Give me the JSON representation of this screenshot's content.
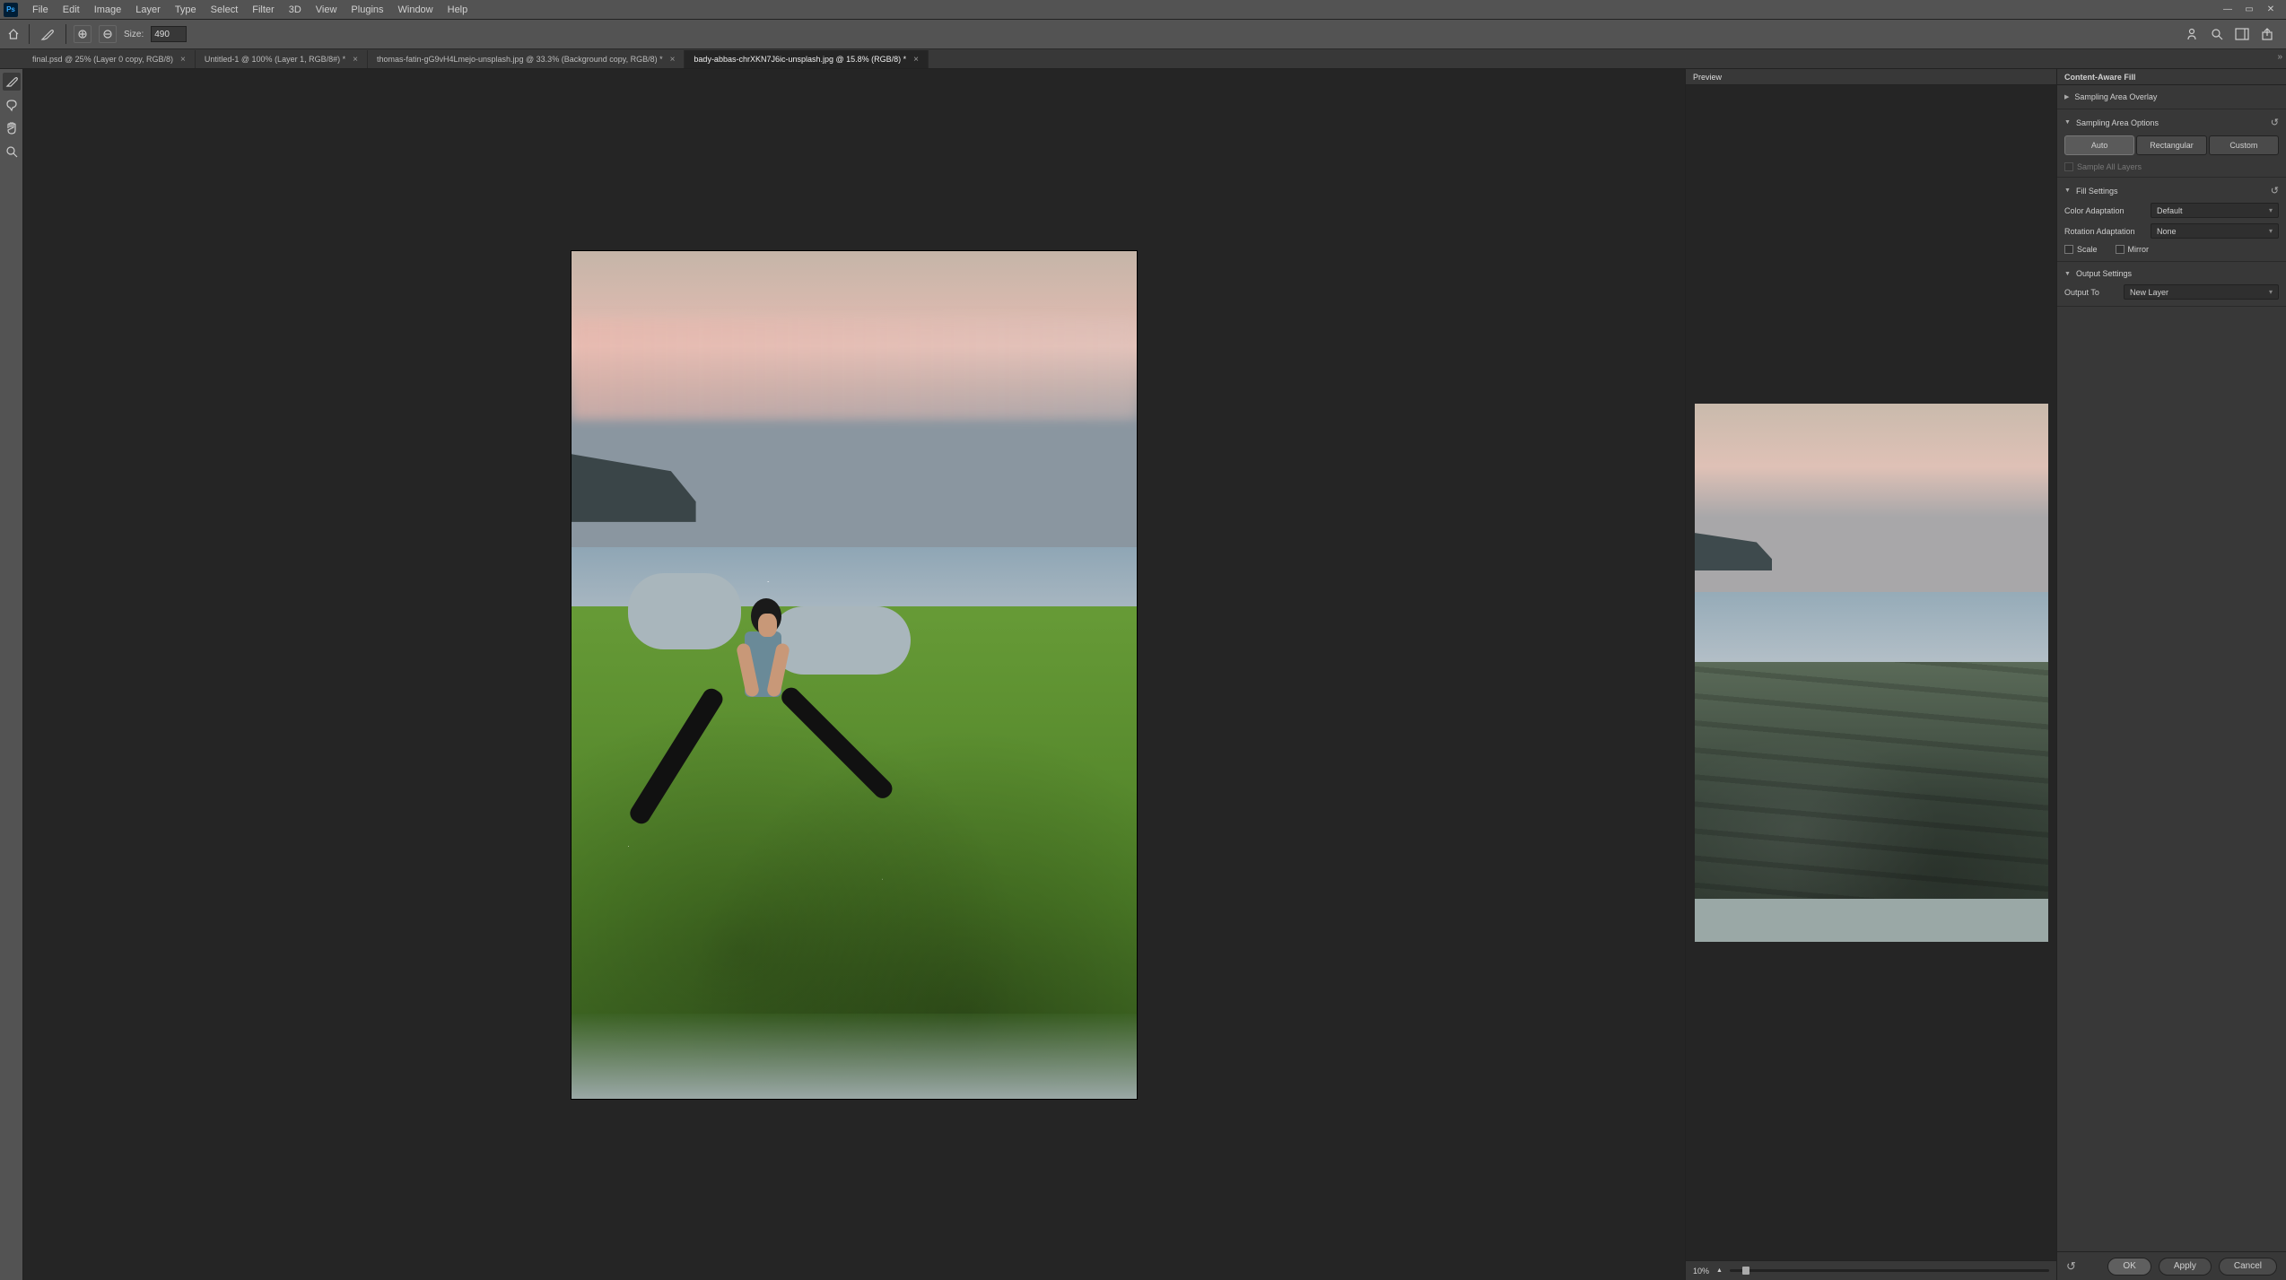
{
  "menubar": [
    "File",
    "Edit",
    "Image",
    "Layer",
    "Type",
    "Select",
    "Filter",
    "3D",
    "View",
    "Plugins",
    "Window",
    "Help"
  ],
  "optionsbar": {
    "size_label": "Size:",
    "size_value": "490"
  },
  "tabs": [
    {
      "label": "final.psd @ 25% (Layer 0 copy, RGB/8)",
      "active": false
    },
    {
      "label": "Untitled-1 @ 100% (Layer 1, RGB/8#) *",
      "active": false
    },
    {
      "label": "thomas-fatin-gG9vH4Lmejo-unsplash.jpg @ 33.3% (Background copy, RGB/8) *",
      "active": false
    },
    {
      "label": "bady-abbas-chrXKN7J6ic-unsplash.jpg @ 15.8% (RGB/8) *",
      "active": true
    }
  ],
  "preview": {
    "tab_label": "Preview",
    "zoom": "10%"
  },
  "props": {
    "title": "Content-Aware Fill",
    "sec1": {
      "label": "Sampling Area Overlay"
    },
    "sec2": {
      "label": "Sampling Area Options",
      "buttons": [
        "Auto",
        "Rectangular",
        "Custom"
      ],
      "active": 0,
      "sample_all": "Sample All Layers"
    },
    "sec3": {
      "label": "Fill Settings",
      "color_adapt_label": "Color Adaptation",
      "color_adapt_value": "Default",
      "rotation_label": "Rotation Adaptation",
      "rotation_value": "None",
      "scale_label": "Scale",
      "mirror_label": "Mirror"
    },
    "sec4": {
      "label": "Output Settings",
      "output_to_label": "Output To",
      "output_to_value": "New Layer"
    },
    "buttons": {
      "ok": "OK",
      "apply": "Apply",
      "cancel": "Cancel"
    }
  }
}
